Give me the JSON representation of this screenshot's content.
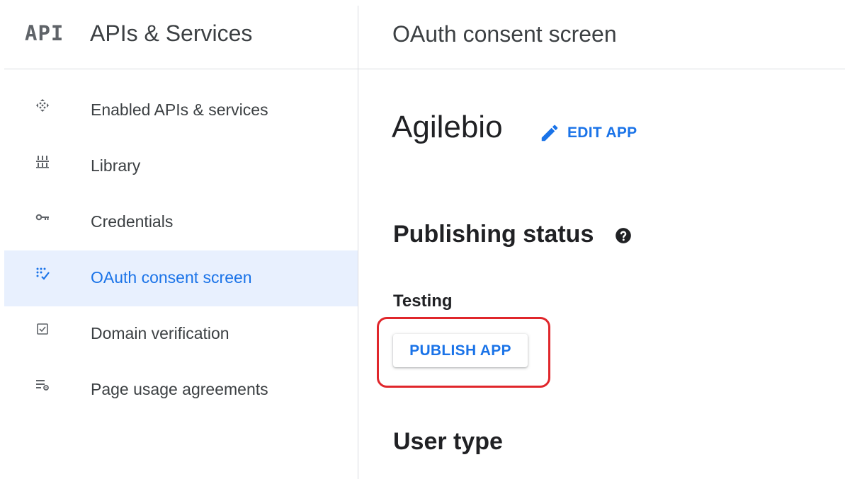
{
  "sidebar": {
    "logo": "API",
    "title": "APIs & Services",
    "items": [
      {
        "label": "Enabled APIs & services",
        "icon": "enabled-apis-icon"
      },
      {
        "label": "Library",
        "icon": "library-icon"
      },
      {
        "label": "Credentials",
        "icon": "key-icon"
      },
      {
        "label": "OAuth consent screen",
        "icon": "oauth-consent-icon",
        "active": true
      },
      {
        "label": "Domain verification",
        "icon": "checkbox-icon"
      },
      {
        "label": "Page usage agreements",
        "icon": "settings-list-icon"
      }
    ]
  },
  "main": {
    "page_title": "OAuth consent screen",
    "app_name": "Agilebio",
    "edit_label": "EDIT APP",
    "publishing_heading": "Publishing status",
    "publishing_status": "Testing",
    "publish_label": "PUBLISH APP",
    "user_type_heading": "User type"
  },
  "colors": {
    "accent": "#1a73e8",
    "active_bg": "#e8f0fe",
    "highlight": "#e0262b",
    "divider": "#dadce0"
  }
}
